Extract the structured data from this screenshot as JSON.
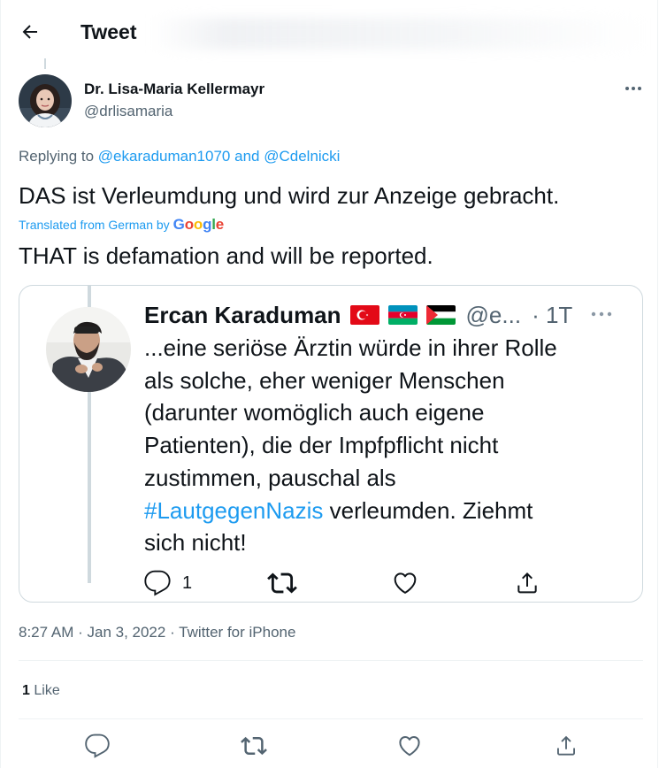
{
  "header": {
    "title": "Tweet",
    "back_icon": "arrow-left-icon"
  },
  "author": {
    "name": "Dr. Lisa-Maria Kellermayr",
    "handle": "@drlisamaria"
  },
  "reply": {
    "prefix": "Replying to",
    "user1": "@ekaraduman1070",
    "joiner": "and",
    "user2": "@Cdelnicki"
  },
  "tweet": {
    "text": "DAS ist Verleumdung und wird zur Anzeige gebracht.",
    "translated_label": "Translated from German by",
    "google_logo": "Google",
    "translation": "THAT is defamation and will be reported."
  },
  "quote": {
    "name": "Ercan Karaduman",
    "flags": [
      "turkey-flag",
      "azerbaijan-flag",
      "palestine-flag"
    ],
    "handle": "@e...",
    "time": "· 1T",
    "line1": "...eine seriöse Ärztin würde in ihrer Rolle",
    "line2": "als solche, eher weniger Menschen",
    "line3": "(darunter womöglich auch eigene",
    "line4": "Patienten), die der Impfpflicht nicht",
    "line5": "zustimmen, pauschal als",
    "hashtag": "#LautgegenNazis",
    "line6_rest": " verleumden. Ziehmt",
    "line7": "sich nicht!",
    "reply_count": "1"
  },
  "meta": {
    "time": "8:27 AM",
    "sep1": " · ",
    "date": "Jan 3, 2022",
    "sep2": " · ",
    "source": "Twitter for iPhone"
  },
  "likes": {
    "count": "1",
    "label": "Like"
  },
  "colors": {
    "accent": "#1d9bf0",
    "secondary_text": "#536471",
    "border": "#cfd9de"
  }
}
